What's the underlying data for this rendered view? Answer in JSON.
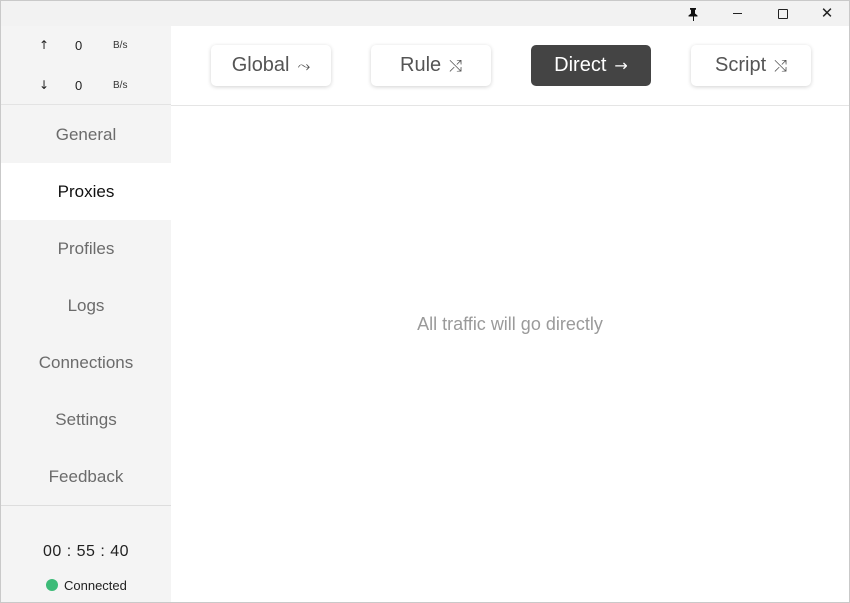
{
  "titlebar": {
    "pin_icon": "pin-icon",
    "minimize_icon": "minimize-icon",
    "maximize_icon": "maximize-icon",
    "close_icon": "close-icon"
  },
  "traffic": {
    "upload": {
      "arrow": "↑",
      "value": "0",
      "unit": "B/s"
    },
    "download": {
      "arrow": "↓",
      "value": "0",
      "unit": "B/s"
    }
  },
  "nav": {
    "items": [
      {
        "label": "General"
      },
      {
        "label": "Proxies"
      },
      {
        "label": "Profiles"
      },
      {
        "label": "Logs"
      },
      {
        "label": "Connections"
      },
      {
        "label": "Settings"
      },
      {
        "label": "Feedback"
      }
    ],
    "active": "Proxies"
  },
  "footer": {
    "uptime": "00 : 55 : 40",
    "status": "Connected",
    "status_color": "#3dbb78"
  },
  "modes": [
    {
      "label": "Global",
      "icon": "⤳"
    },
    {
      "label": "Rule",
      "icon": "⤭"
    },
    {
      "label": "Direct",
      "icon": "→"
    },
    {
      "label": "Script",
      "icon": "⤭"
    }
  ],
  "active_mode": "Direct",
  "content": {
    "message": "All traffic will go directly"
  },
  "colors": {
    "active_mode_bg": "#444444",
    "sidebar_bg": "#f4f4f4"
  }
}
